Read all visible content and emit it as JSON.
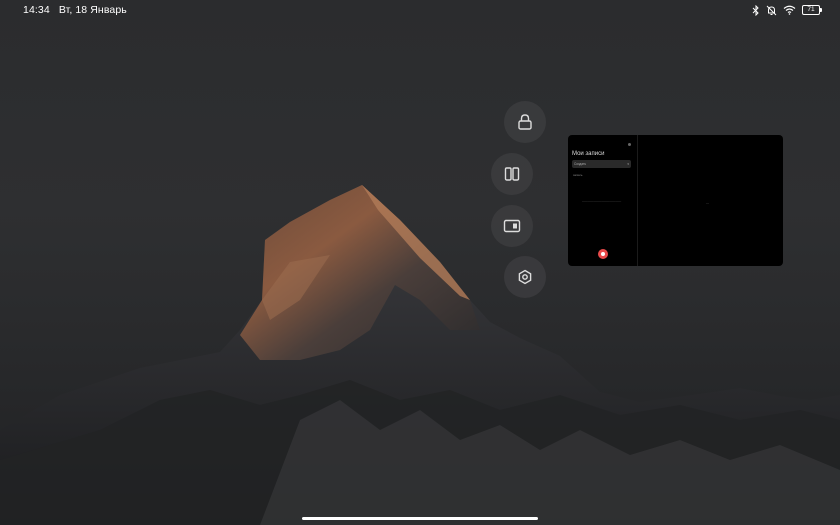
{
  "status_bar": {
    "time": "14:34",
    "date": "Вт, 18 Январь",
    "battery": "71",
    "icons": [
      "bluetooth-icon",
      "bell-off-icon",
      "wifi-icon",
      "battery-icon"
    ]
  },
  "quick_actions": [
    {
      "name": "lock",
      "icon": "lock-icon"
    },
    {
      "name": "split-screen",
      "icon": "split-screen-icon"
    },
    {
      "name": "floating-window",
      "icon": "floating-window-icon"
    },
    {
      "name": "settings",
      "icon": "settings-icon"
    }
  ],
  "app_preview": {
    "title": "Мои записи",
    "dropdown": "Создать",
    "subtitle": "запись"
  },
  "colors": {
    "record_button": "#e84a4a",
    "background": "#2b2c2e"
  }
}
